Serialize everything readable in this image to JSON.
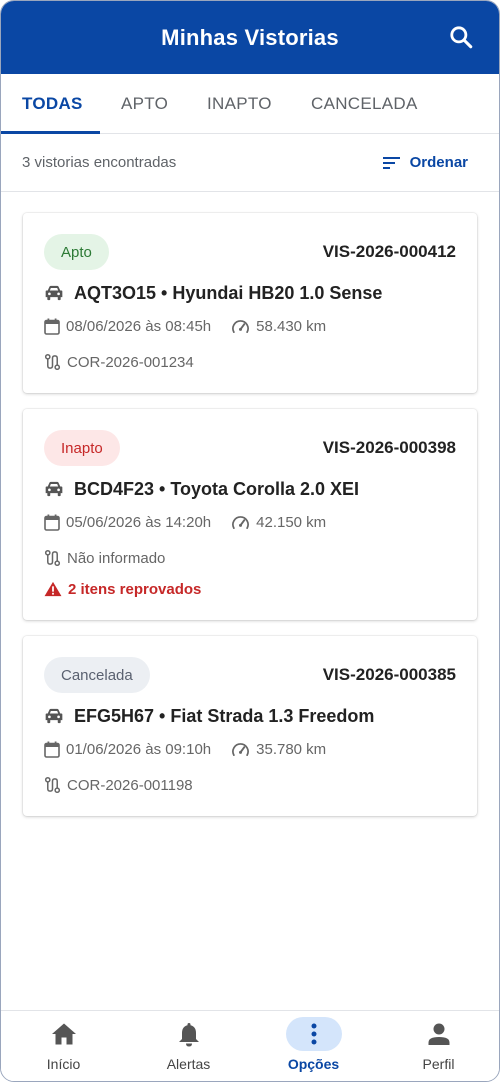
{
  "header": {
    "title": "Minhas Vistorias"
  },
  "tabs": [
    {
      "label": "TODAS",
      "active": true
    },
    {
      "label": "APTO"
    },
    {
      "label": "INAPTO"
    },
    {
      "label": "CANCELADA"
    }
  ],
  "summary": {
    "count_text": "3 vistorias encontradas",
    "sort_label": "Ordenar"
  },
  "cards": [
    {
      "status": "Apto",
      "code": "VIS-2026-000412",
      "vehicle": "AQT3O15 • Hyundai HB20 1.0 Sense",
      "date": "08/06/2026 às 08:45h",
      "km": "58.430 km",
      "route": "COR-2026-001234"
    },
    {
      "status": "Inapto",
      "code": "VIS-2026-000398",
      "vehicle": "BCD4F23 • Toyota Corolla 2.0 XEI",
      "date": "05/06/2026 às 14:20h",
      "km": "42.150 km",
      "route": "Não informado",
      "alert": "2 itens reprovados"
    },
    {
      "status": "Cancelada",
      "code": "VIS-2026-000385",
      "vehicle": "EFG5H67 • Fiat Strada 1.3 Freedom",
      "date": "01/06/2026 às 09:10h",
      "km": "35.780 km",
      "route": "COR-2026-001198"
    }
  ],
  "bottom_nav": [
    {
      "label": "Início",
      "icon": "home-icon"
    },
    {
      "label": "Alertas",
      "icon": "bell-icon"
    },
    {
      "label": "Opções",
      "icon": "more-vertical-icon",
      "active": true
    },
    {
      "label": "Perfil",
      "icon": "person-icon"
    }
  ],
  "colors": {
    "primary": "#0a47a4",
    "apto_bg": "#e4f4e6",
    "apto_fg": "#2c7a35",
    "inapto_bg": "#fde7e7",
    "inapto_fg": "#c62828",
    "cancelada_bg": "#eceff3",
    "cancelada_fg": "#5a6170"
  }
}
